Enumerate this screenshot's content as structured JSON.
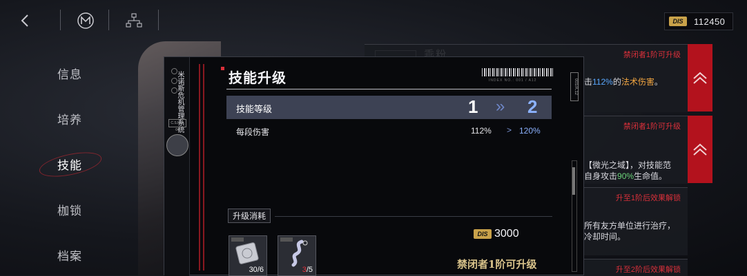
{
  "topbar": {
    "back_icon": "chevron-left-icon",
    "emblem_icon": "m-emblem-icon",
    "tree_icon": "hierarchy-icon",
    "currency": {
      "icon": "DIS",
      "value": "112450"
    }
  },
  "nav": {
    "items": [
      {
        "label": "信息"
      },
      {
        "label": "培养"
      },
      {
        "label": "技能"
      },
      {
        "label": "枷锁"
      },
      {
        "label": "档案"
      }
    ],
    "active_index": 2
  },
  "background_panels": {
    "title": "乖粉",
    "panels": [
      {
        "head": "禁闭者1阶可升级",
        "text_pre": "击",
        "text_blue": "112%",
        "text_mid": "的",
        "text_orange": "法术伤害",
        "text_post": "。"
      },
      {
        "head": "禁闭者1阶可升级",
        "line1": "【微光之域】，对技能范",
        "line2_pre": "自身攻击",
        "line2_green": "90%",
        "line2_post": "生命值。"
      },
      {
        "head": "升至1阶后效果解锁",
        "line1": "所有友方单位进行治疗，",
        "line2": "冷却时间。"
      },
      {
        "head": "升至2阶后效果解锁"
      }
    ]
  },
  "modal": {
    "side_text": "米诺斯危机管理系统",
    "side_badge": "C.S.M.P. 04",
    "title": "技能升级",
    "barcode_caption": "INDEX NO.: 001 / A12",
    "side_code": "001/A.12",
    "level_row": {
      "label": "技能等级",
      "from": "1",
      "arrow": "»",
      "to": "2"
    },
    "damage_row": {
      "label": "每段伤害",
      "from": "112%",
      "arrow": ">",
      "to": "120%"
    },
    "cost": {
      "label": "升级消耗",
      "items": [
        {
          "icon": "silver-plate-icon",
          "have": "30",
          "need": "6"
        },
        {
          "icon": "tentacle-icon",
          "have": "3",
          "need": "5"
        }
      ],
      "coin_icon": "DIS",
      "coin_value": "3000"
    },
    "unlock_text": "禁闭者1阶可升级"
  }
}
